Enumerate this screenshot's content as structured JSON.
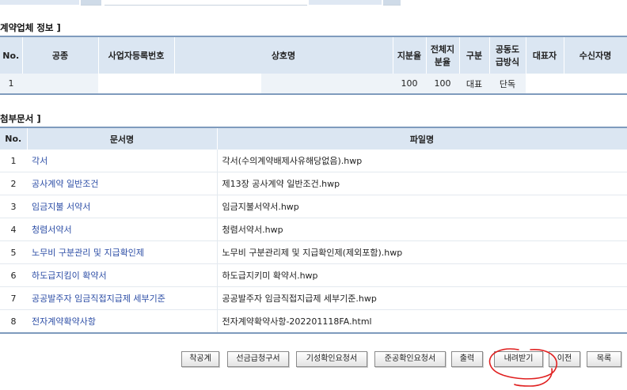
{
  "contractors": {
    "title": "계약업체 정보 ]",
    "headers": [
      "No.",
      "공종",
      "사업자등록번호",
      "상호명",
      "지분율",
      "전체지분율",
      "구분",
      "공동도급방식",
      "대표자",
      "수신자명"
    ],
    "header_lines": {
      "full_share": [
        "전체지",
        "분율"
      ],
      "joint_method": [
        "공동도",
        "급방식"
      ]
    },
    "rows": [
      {
        "no": "1",
        "type": "",
        "bizno": "",
        "name": "",
        "share": "100",
        "total_share": "100",
        "category": "대표",
        "method": "단독",
        "rep": "",
        "receiver": ""
      }
    ]
  },
  "attachments": {
    "title": "첨부문서 ]",
    "headers": {
      "no": "No.",
      "doc": "문서명",
      "file": "파일명"
    },
    "rows": [
      {
        "no": "1",
        "doc": "각서",
        "file": "각서(수의계약배제사유해당없음).hwp"
      },
      {
        "no": "2",
        "doc": "공사계약 일반조건",
        "file": "제13장 공사계약 일반조건.hwp"
      },
      {
        "no": "3",
        "doc": "임금지불 서약서",
        "file": "임금지불서약서.hwp"
      },
      {
        "no": "4",
        "doc": "청렴서약서",
        "file": "청렴서약서.hwp"
      },
      {
        "no": "5",
        "doc": "노무비 구분관리 및 지급확인제",
        "file": "노무비 구분관리제 및 지급확인제(제외포함).hwp"
      },
      {
        "no": "6",
        "doc": "하도급지킴이 확약서",
        "file": "하도급지키미 확약서.hwp"
      },
      {
        "no": "7",
        "doc": "공공발주자 임금직접지급제 세부기준",
        "file": "공공발주자 임금직접지급제 세부기준.hwp"
      },
      {
        "no": "8",
        "doc": "전자계약확약사항",
        "file": "전자계약확약사항-202201118FA.html"
      }
    ]
  },
  "buttons": {
    "commencement": "착공계",
    "advance_request": "선금급청구서",
    "progress_confirm": "기성확인요청서",
    "completion_confirm": "준공확인요청서",
    "print": "출력",
    "download": "내려받기",
    "previous": "이전",
    "list": "목록"
  },
  "annotation_color": "#e02020"
}
